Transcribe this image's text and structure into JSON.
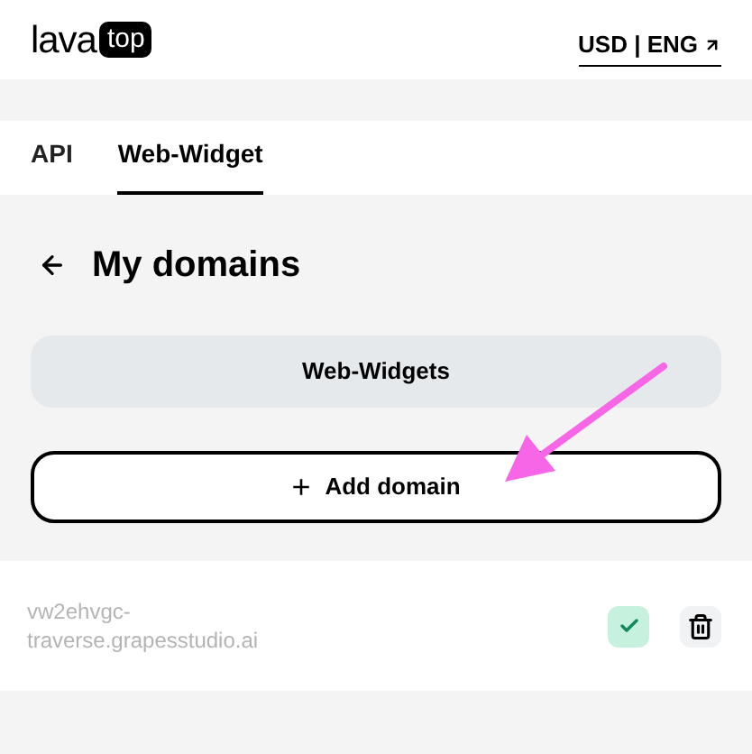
{
  "header": {
    "logo": {
      "word": "lava",
      "badge": "top"
    },
    "locale_link": "USD | ENG"
  },
  "tabs": [
    {
      "label": "API",
      "selected": false
    },
    {
      "label": "Web-Widget",
      "selected": true
    }
  ],
  "page_title": "My domains",
  "segment": {
    "label": "Web-Widgets"
  },
  "add_button": {
    "icon": "+",
    "label": "Add domain"
  },
  "domains": [
    {
      "name": "vw2ehvgc-traverse.grapesstudio.ai",
      "verified": true
    }
  ]
}
